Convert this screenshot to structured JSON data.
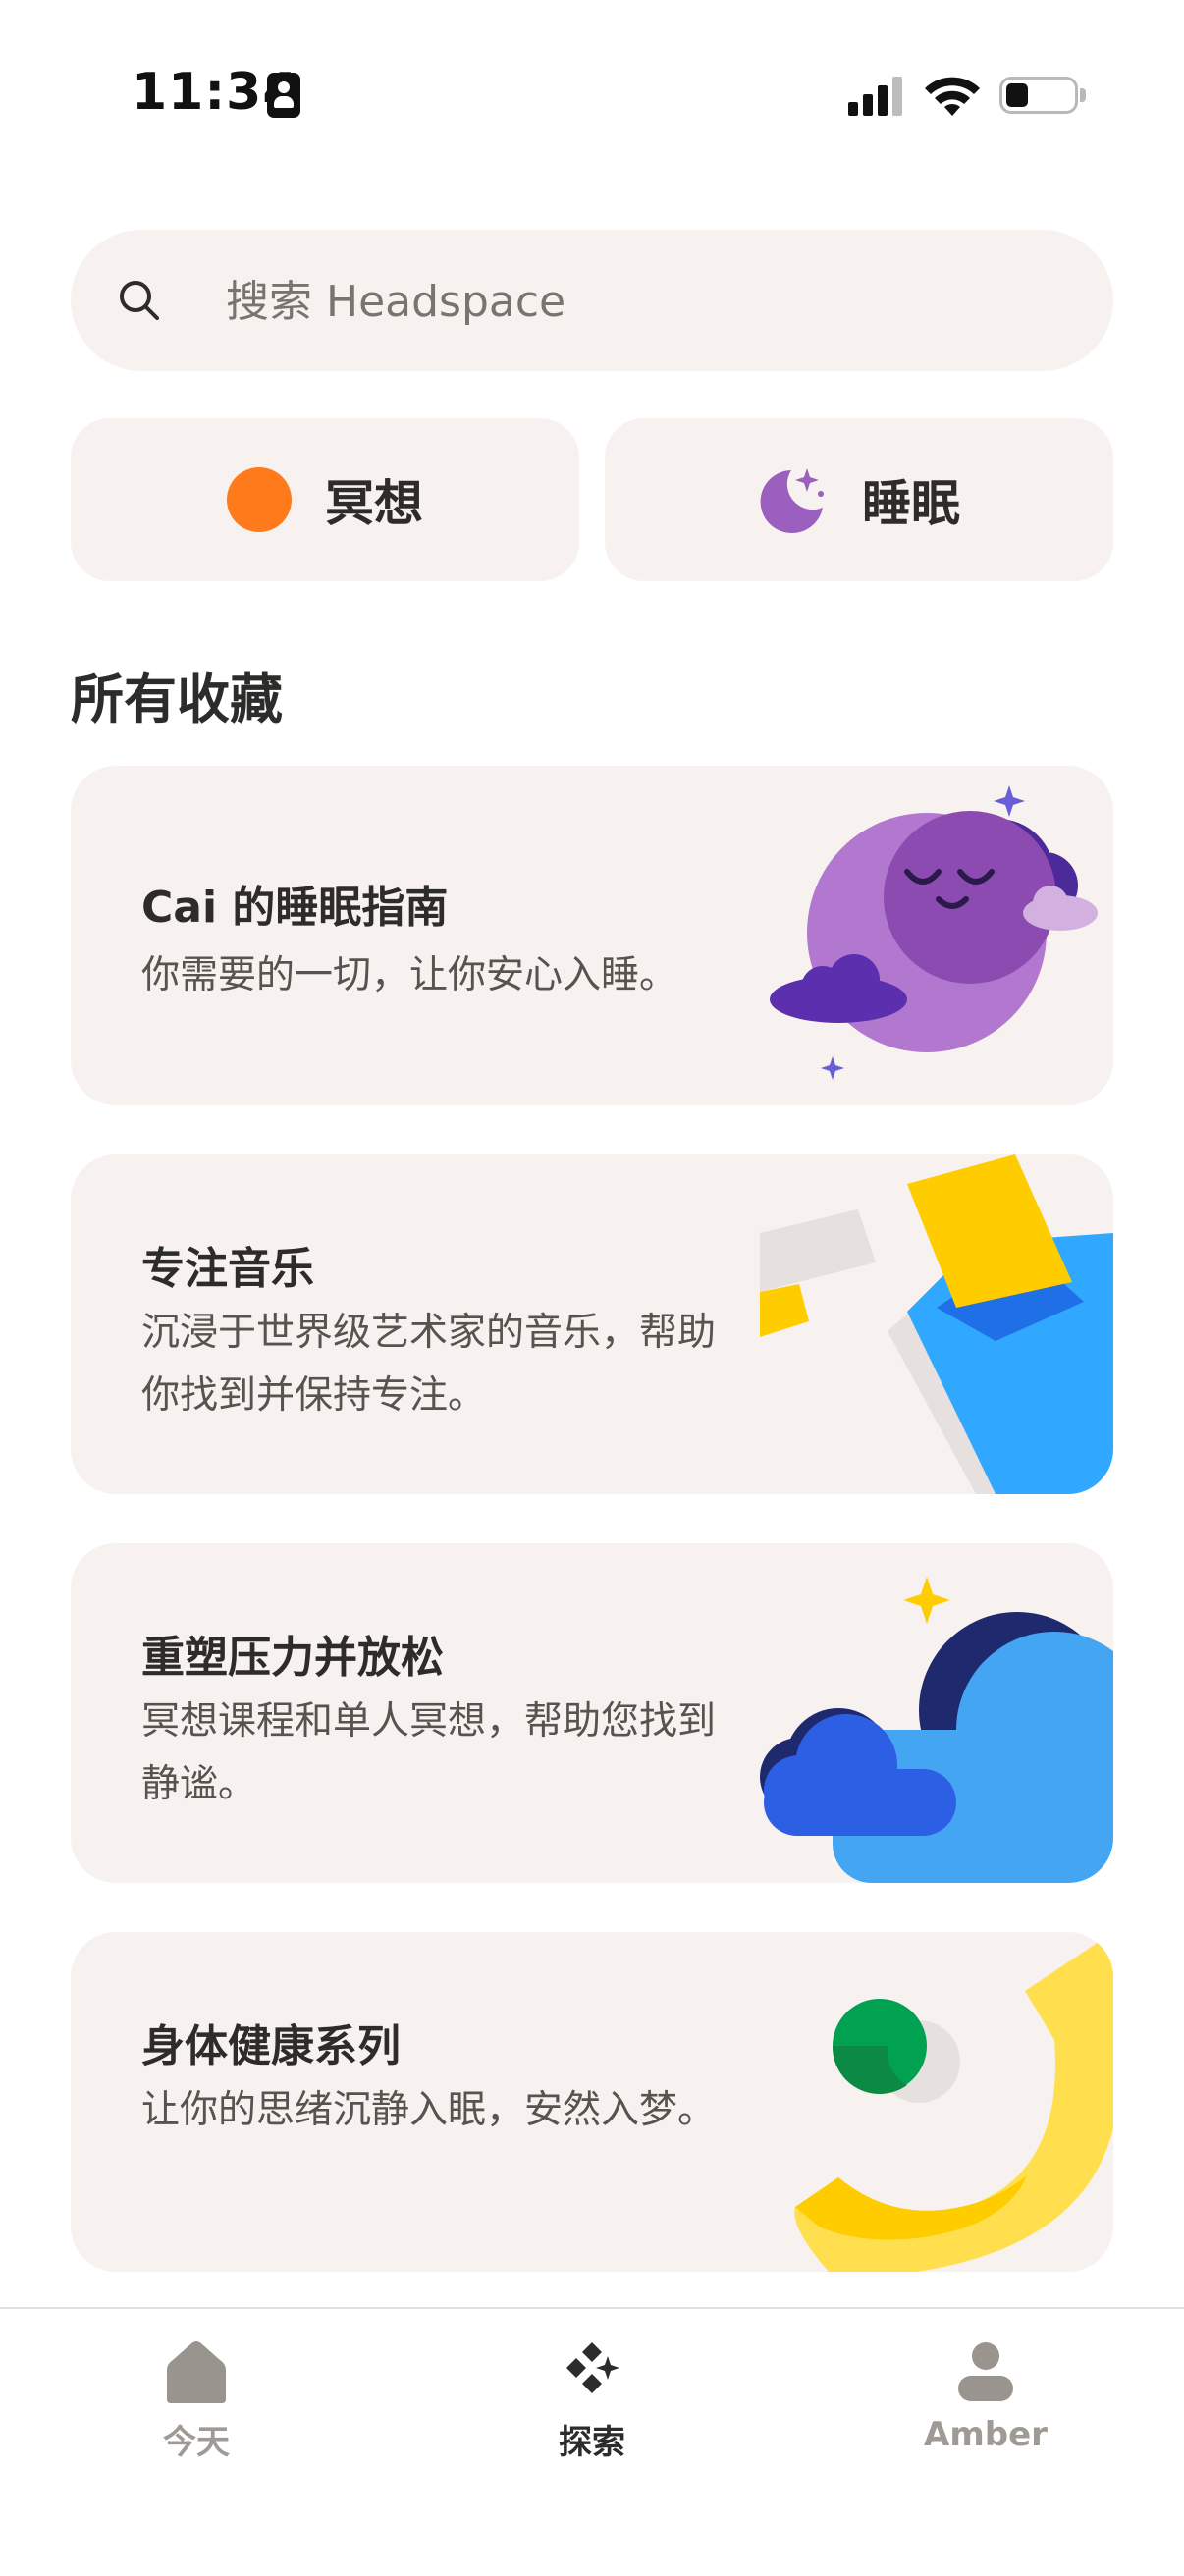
{
  "status": {
    "time": "11:34"
  },
  "search": {
    "placeholder": "搜索 Headspace"
  },
  "chips": [
    {
      "label": "冥想"
    },
    {
      "label": "睡眠"
    }
  ],
  "section": {
    "title": "所有收藏"
  },
  "cards": [
    {
      "title": "Cai 的睡眠指南",
      "description": "你需要的一切，让你安心入睡。"
    },
    {
      "title": "专注音乐",
      "description": "沉浸于世界级艺术家的音乐，帮助你找到并保持专注。"
    },
    {
      "title": "重塑压力并放松",
      "description": "冥想课程和单人冥想，帮助您找到静谧。"
    },
    {
      "title": "身体健康系列",
      "description": "让你的思绪沉静入眠，安然入梦。"
    }
  ],
  "tabbar": {
    "items": [
      {
        "label": "今天",
        "icon": "home-icon",
        "active": false
      },
      {
        "label": "探索",
        "icon": "explore-icon",
        "active": true
      },
      {
        "label": "Amber",
        "icon": "profile-icon",
        "active": false
      }
    ]
  },
  "colors": {
    "background": "#ffffff",
    "card": "#f7f2ef",
    "text": "#2d2c2b",
    "accent_orange": "#ff7a1a",
    "sleep_purple": "#9b5fc0"
  }
}
